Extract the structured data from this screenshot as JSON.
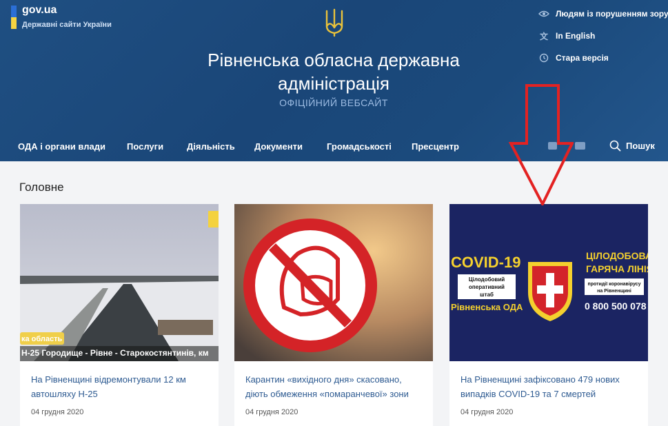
{
  "gov": {
    "title": "gov.ua",
    "subtitle": "Державні сайти України"
  },
  "site": {
    "title_line1": "Рівненська обласна державна",
    "title_line2": "адміністрація",
    "subtitle": "ОФІЦІЙНИЙ ВЕБСАЙТ"
  },
  "utility": [
    {
      "label": "Людям із порушенням зору",
      "icon": "eye-icon"
    },
    {
      "label": "In English",
      "icon": "translate-icon"
    },
    {
      "label": "Стара версія",
      "icon": "history-icon"
    }
  ],
  "nav": [
    {
      "label": "ОДА і органи влади"
    },
    {
      "label": "Послуги"
    },
    {
      "label": "Діяльність"
    },
    {
      "label": "Документи"
    },
    {
      "label": "Громадськості"
    },
    {
      "label": "Пресцентр"
    }
  ],
  "search": {
    "label": "Пошук"
  },
  "main": {
    "section_title": "Головне"
  },
  "cards": [
    {
      "headline": "На Рівненщині відремонтували 12 км автошляху Н-25",
      "date": "04 грудня 2020",
      "image_caption_1": "ка область",
      "image_caption_2": "Н-25 Городище - Рівне - Старокостянтинів, км"
    },
    {
      "headline": "Карантин «вихідного дня» скасовано, діють обмеження «помаранчевої» зони",
      "date": "04 грудня 2020"
    },
    {
      "headline": "На Рівненщині зафіксовано 479 нових випадків COVID-19 та 7 смертей",
      "date": "04 грудня 2020",
      "banner": {
        "left_title": "COVID-19",
        "left_box": "Цілодобовий оперативний штаб",
        "left_org": "Рівненська ОДА",
        "right_title_1": "ЦІЛОДОБОВА",
        "right_title_2": "ГАРЯЧА ЛІНІЯ",
        "right_box": "протидії коронавірусу на Рівненщині",
        "phone": "0 800 500 078"
      }
    }
  ],
  "colors": {
    "header_bg": "#1d4b7e",
    "link": "#2d5a91",
    "annotation_arrow": "#e32222"
  }
}
